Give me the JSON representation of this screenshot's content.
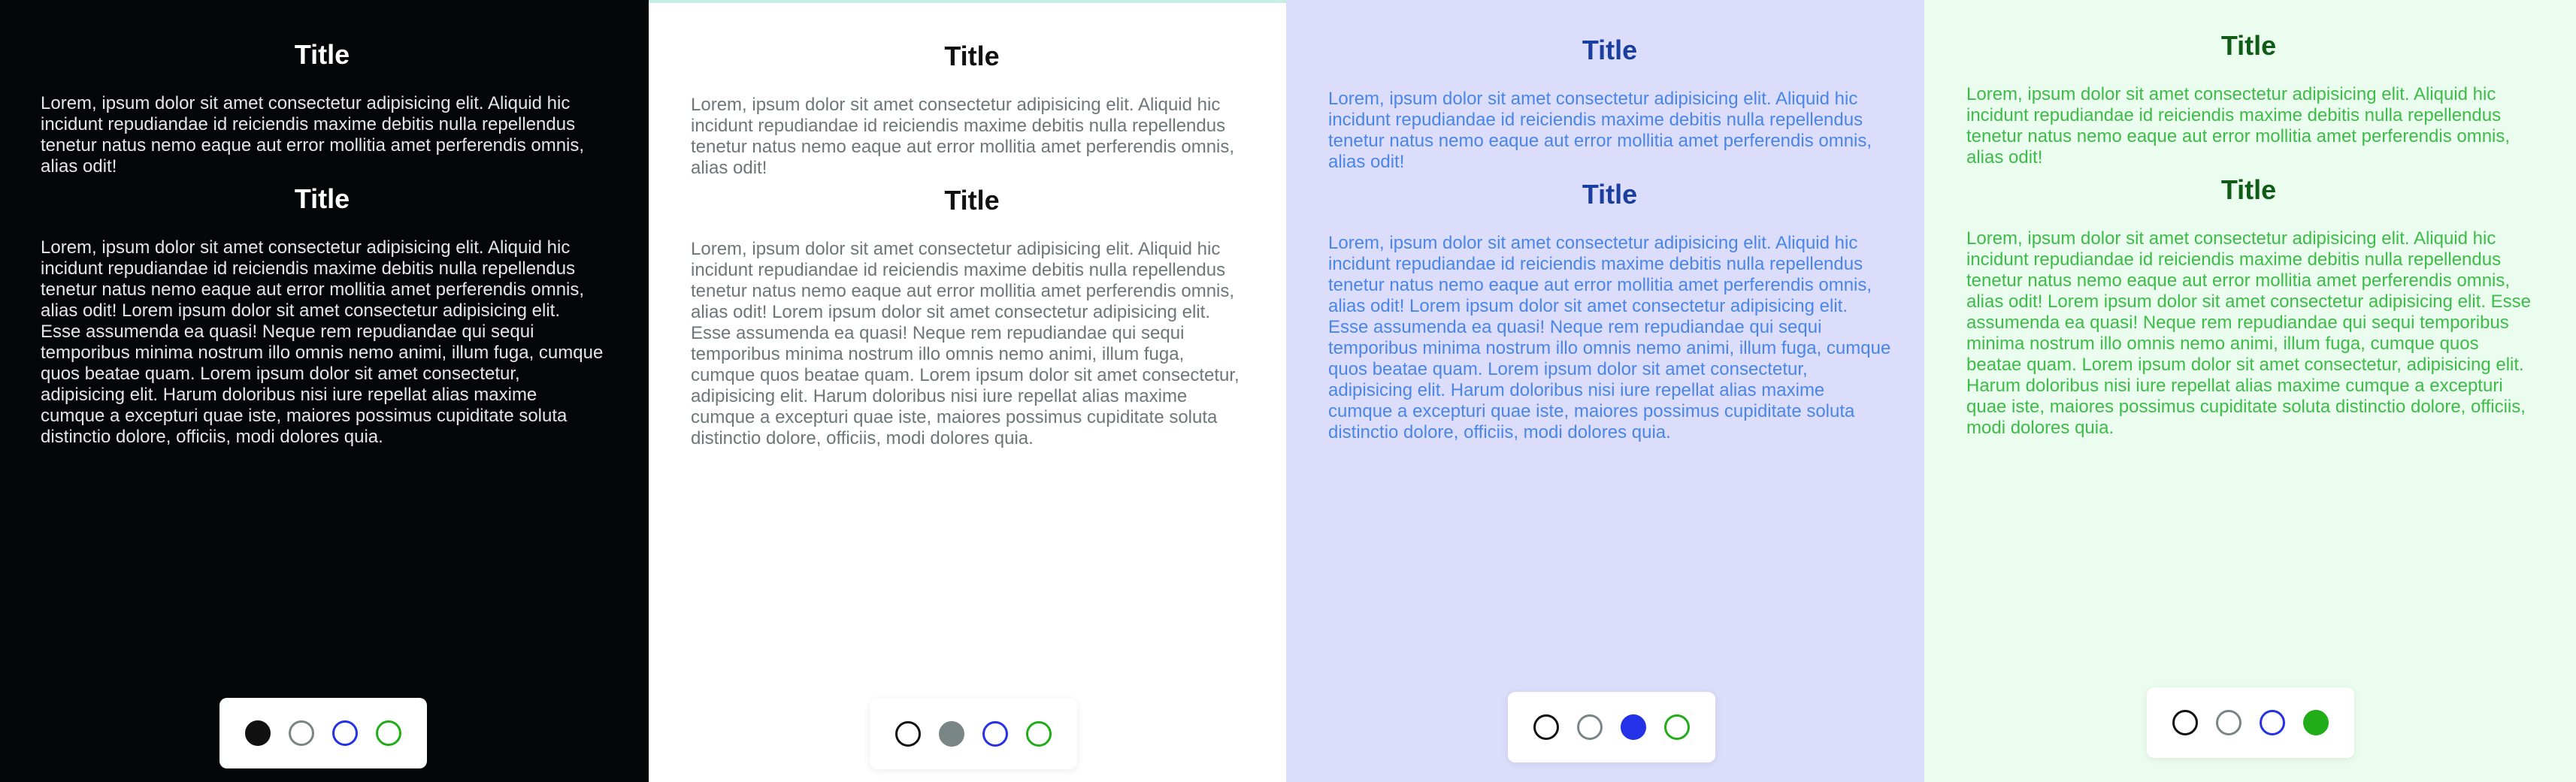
{
  "themes": [
    {
      "id": "dark",
      "title_1": "Title",
      "paragraph_1": "Lorem, ipsum dolor sit amet consectetur adipisicing elit. Aliquid hic incidunt repudiandae id reiciendis maxime debitis nulla repellendus tenetur natus nemo eaque aut error mollitia amet perferendis omnis, alias odit!",
      "title_2": "Title",
      "paragraph_2": "Lorem, ipsum dolor sit amet consectetur adipisicing elit. Aliquid hic incidunt repudiandae id reiciendis maxime debitis nulla repellendus tenetur natus nemo eaque aut error mollitia amet perferendis omnis, alias odit! Lorem ipsum dolor sit amet consectetur adipisicing elit. Esse assumenda ea quasi! Neque rem repudiandae qui sequi temporibus minima nostrum illo omnis nemo animi, illum fuga, cumque quos beatae quam. Lorem ipsum dolor sit amet consectetur, adipisicing elit. Harum doloribus nisi iure repellat alias maxime cumque a excepturi quae iste, maiores possimus cupiditate soluta distinctio dolore, officiis, modi dolores quia.",
      "background": "#050607",
      "title_color": "#ffffff",
      "text_color": "#e6e6e6",
      "active_option": "dark"
    },
    {
      "id": "light",
      "title_1": "Title",
      "paragraph_1": "Lorem, ipsum dolor sit amet consectetur adipisicing elit. Aliquid hic incidunt repudiandae id reiciendis maxime debitis nulla repellendus tenetur natus nemo eaque aut error mollitia amet perferendis omnis, alias odit!",
      "title_2": "Title",
      "paragraph_2": "Lorem, ipsum dolor sit amet consectetur adipisicing elit. Aliquid hic incidunt repudiandae id reiciendis maxime debitis nulla repellendus tenetur natus nemo eaque aut error mollitia amet perferendis omnis, alias odit! Lorem ipsum dolor sit amet consectetur adipisicing elit. Esse assumenda ea quasi! Neque rem repudiandae qui sequi temporibus minima nostrum illo omnis nemo animi, illum fuga, cumque quos beatae quam. Lorem ipsum dolor sit amet consectetur, adipisicing elit. Harum doloribus nisi iure repellat alias maxime cumque a excepturi quae iste, maiores possimus cupiditate soluta distinctio dolore, officiis, modi dolores quia.",
      "background": "#ffffff",
      "title_color": "#111111",
      "text_color": "#6e7778",
      "active_option": "light"
    },
    {
      "id": "blue",
      "title_1": "Title",
      "paragraph_1": "Lorem, ipsum dolor sit amet consectetur adipisicing elit. Aliquid hic incidunt repudiandae id reiciendis maxime debitis nulla repellendus tenetur natus nemo eaque aut error mollitia amet perferendis omnis, alias odit!",
      "title_2": "Title",
      "paragraph_2": "Lorem, ipsum dolor sit amet consectetur adipisicing elit. Aliquid hic incidunt repudiandae id reiciendis maxime debitis nulla repellendus tenetur natus nemo eaque aut error mollitia amet perferendis omnis, alias odit! Lorem ipsum dolor sit amet consectetur adipisicing elit. Esse assumenda ea quasi! Neque rem repudiandae qui sequi temporibus minima nostrum illo omnis nemo animi, illum fuga, cumque quos beatae quam. Lorem ipsum dolor sit amet consectetur, adipisicing elit. Harum doloribus nisi iure repellat alias maxime cumque a excepturi quae iste, maiores possimus cupiditate soluta distinctio dolore, officiis, modi dolores quia.",
      "background": "#dcdcfb",
      "title_color": "#1b3f9e",
      "text_color": "#4a86e8",
      "active_option": "blue"
    },
    {
      "id": "green",
      "title_1": "Title",
      "paragraph_1": "Lorem, ipsum dolor sit amet consectetur adipisicing elit. Aliquid hic incidunt repudiandae id reiciendis maxime debitis nulla repellendus tenetur natus nemo eaque aut error mollitia amet perferendis omnis, alias odit!",
      "title_2": "Title",
      "paragraph_2": "Lorem, ipsum dolor sit amet consectetur adipisicing elit. Aliquid hic incidunt repudiandae id reiciendis maxime debitis nulla repellendus tenetur natus nemo eaque aut error mollitia amet perferendis omnis, alias odit! Lorem ipsum dolor sit amet consectetur adipisicing elit. Esse assumenda ea quasi! Neque rem repudiandae qui sequi temporibus minima nostrum illo omnis nemo animi, illum fuga, cumque quos beatae quam. Lorem ipsum dolor sit amet consectetur, adipisicing elit. Harum doloribus nisi iure repellat alias maxime cumque a excepturi quae iste, maiores possimus cupiditate soluta distinctio dolore, officiis, modi dolores quia.",
      "background": "#ebfdef",
      "title_color": "#0f5c16",
      "text_color": "#3dbc47",
      "active_option": "green"
    }
  ],
  "theme_options": [
    {
      "id": "dark",
      "color": "#111111"
    },
    {
      "id": "light",
      "color": "#7a8586"
    },
    {
      "id": "blue",
      "color": "#2431e6"
    },
    {
      "id": "green",
      "color": "#21ad17"
    }
  ]
}
